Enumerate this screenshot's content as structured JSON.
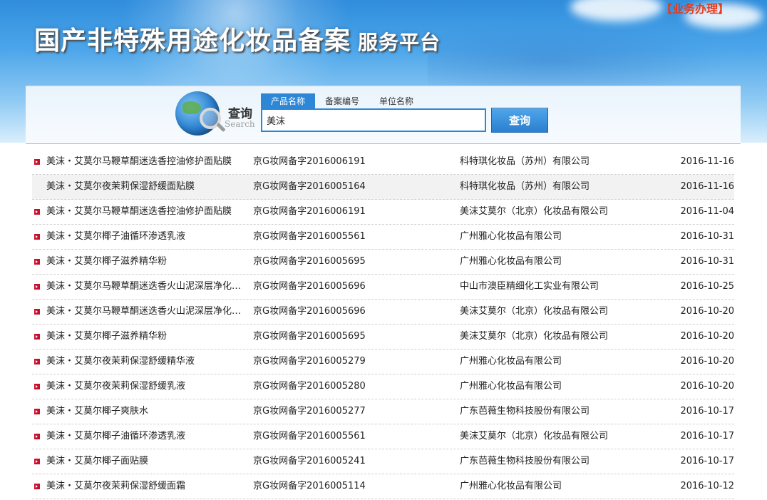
{
  "header": {
    "title": "国产非特殊用途化妆品备案",
    "subtitle": "服务平台",
    "biz_link": "【业务办理】"
  },
  "search": {
    "label_cn": "查询",
    "label_en": "Search",
    "tabs": [
      {
        "label": "产品名称",
        "active": true
      },
      {
        "label": "备案编号",
        "active": false
      },
      {
        "label": "单位名称",
        "active": false
      }
    ],
    "input_value": "美沫",
    "button_label": "查询"
  },
  "results": [
    {
      "name": "美沫・艾莫尔马鞭草酮迷迭香控油修护面贴膜",
      "code": "京G妆网备字2016006191",
      "company": "科特琪化妆品（苏州）有限公司",
      "date": "2016-11-16",
      "bullet": true
    },
    {
      "name": "美沫・艾莫尔夜茉莉保湿舒缓面贴膜",
      "code": "京G妆网备字2016005164",
      "company": "科特琪化妆品（苏州）有限公司",
      "date": "2016-11-16",
      "bullet": false
    },
    {
      "name": "美沫・艾莫尔马鞭草酮迷迭香控油修护面贴膜",
      "code": "京G妆网备字2016006191",
      "company": "美沫艾莫尔（北京）化妆品有限公司",
      "date": "2016-11-04",
      "bullet": true
    },
    {
      "name": "美沫・艾莫尔椰子油循环渗透乳液",
      "code": "京G妆网备字2016005561",
      "company": "广州雅心化妆品有限公司",
      "date": "2016-10-31",
      "bullet": true
    },
    {
      "name": "美沫・艾莫尔椰子滋养精华粉",
      "code": "京G妆网备字2016005695",
      "company": "广州雅心化妆品有限公司",
      "date": "2016-10-31",
      "bullet": true
    },
    {
      "name": "美沫・艾莫尔马鞭草酮迷迭香火山泥深层净化面膜",
      "code": "京G妆网备字2016005696",
      "company": "中山市澳臣精细化工实业有限公司",
      "date": "2016-10-25",
      "bullet": true
    },
    {
      "name": "美沫・艾莫尔马鞭草酮迷迭香火山泥深层净化面膜",
      "code": "京G妆网备字2016005696",
      "company": "美沫艾莫尔（北京）化妆品有限公司",
      "date": "2016-10-20",
      "bullet": true
    },
    {
      "name": "美沫・艾莫尔椰子滋养精华粉",
      "code": "京G妆网备字2016005695",
      "company": "美沫艾莫尔（北京）化妆品有限公司",
      "date": "2016-10-20",
      "bullet": true
    },
    {
      "name": "美沫・艾莫尔夜茉莉保湿舒缓精华液",
      "code": "京G妆网备字2016005279",
      "company": "广州雅心化妆品有限公司",
      "date": "2016-10-20",
      "bullet": true
    },
    {
      "name": "美沫・艾莫尔夜茉莉保湿舒缓乳液",
      "code": "京G妆网备字2016005280",
      "company": "广州雅心化妆品有限公司",
      "date": "2016-10-20",
      "bullet": true
    },
    {
      "name": "美沫・艾莫尔椰子爽肤水",
      "code": "京G妆网备字2016005277",
      "company": "广东芭薇生物科技股份有限公司",
      "date": "2016-10-17",
      "bullet": true
    },
    {
      "name": "美沫・艾莫尔椰子油循环渗透乳液",
      "code": "京G妆网备字2016005561",
      "company": "美沫艾莫尔（北京）化妆品有限公司",
      "date": "2016-10-17",
      "bullet": true
    },
    {
      "name": "美沫・艾莫尔椰子面贴膜",
      "code": "京G妆网备字2016005241",
      "company": "广东芭薇生物科技股份有限公司",
      "date": "2016-10-17",
      "bullet": true
    },
    {
      "name": "美沫・艾莫尔夜茉莉保湿舒缓面霜",
      "code": "京G妆网备字2016005114",
      "company": "广州雅心化妆品有限公司",
      "date": "2016-10-12",
      "bullet": true
    }
  ]
}
